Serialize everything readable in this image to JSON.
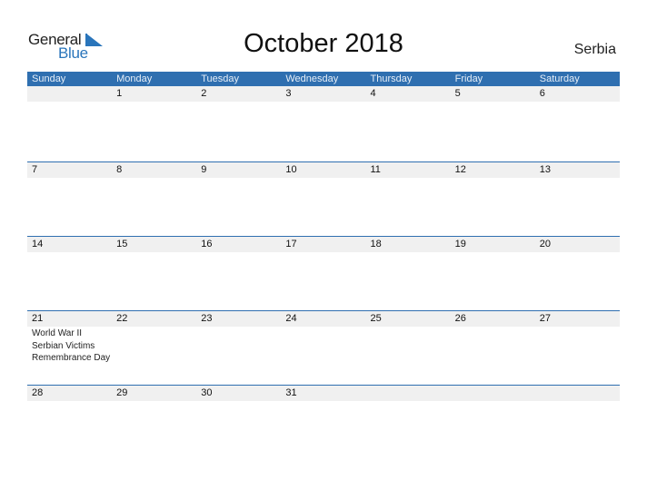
{
  "logo": {
    "general": "General",
    "blue": "Blue",
    "accent": "#2a75bb"
  },
  "title": "October 2018",
  "country": "Serbia",
  "weekdays": [
    "Sunday",
    "Monday",
    "Tuesday",
    "Wednesday",
    "Thursday",
    "Friday",
    "Saturday"
  ],
  "weeks": [
    {
      "dates": [
        "",
        "1",
        "2",
        "3",
        "4",
        "5",
        "6"
      ],
      "events": [
        "",
        "",
        "",
        "",
        "",
        "",
        ""
      ]
    },
    {
      "dates": [
        "7",
        "8",
        "9",
        "10",
        "11",
        "12",
        "13"
      ],
      "events": [
        "",
        "",
        "",
        "",
        "",
        "",
        ""
      ]
    },
    {
      "dates": [
        "14",
        "15",
        "16",
        "17",
        "18",
        "19",
        "20"
      ],
      "events": [
        "",
        "",
        "",
        "",
        "",
        "",
        ""
      ]
    },
    {
      "dates": [
        "21",
        "22",
        "23",
        "24",
        "25",
        "26",
        "27"
      ],
      "events": [
        "World War II\nSerbian Victims\nRemembrance Day",
        "",
        "",
        "",
        "",
        "",
        ""
      ]
    },
    {
      "dates": [
        "28",
        "29",
        "30",
        "31",
        "",
        "",
        ""
      ],
      "events": [
        "",
        "",
        "",
        "",
        "",
        "",
        ""
      ]
    }
  ],
  "colors": {
    "header": "#2f6fb0",
    "datebar": "#f0f0f0"
  }
}
